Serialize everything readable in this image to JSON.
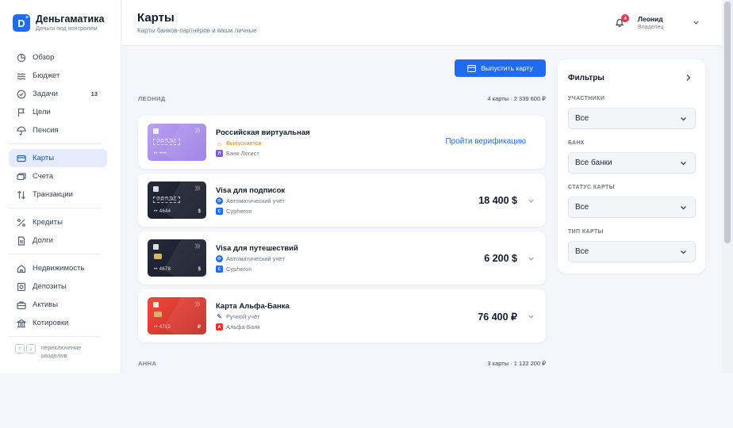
{
  "app": {
    "name": "Деньгаматика",
    "tagline": "Деньги под контролем",
    "logo_letter": "D",
    "logo_plus": "+"
  },
  "sidebar": {
    "items": [
      {
        "label": "Обзор",
        "icon": "pie-chart-icon"
      },
      {
        "label": "Бюджет",
        "icon": "waves-icon"
      },
      {
        "label": "Задачи",
        "icon": "check-circle-icon",
        "badge": "13"
      },
      {
        "label": "Цели",
        "icon": "flag-icon"
      },
      {
        "label": "Пенсия",
        "icon": "umbrella-icon"
      },
      {
        "label": "Карты",
        "icon": "card-icon",
        "active": true
      },
      {
        "label": "Счета",
        "icon": "wallet-icon"
      },
      {
        "label": "Транзакции",
        "icon": "arrows-icon"
      },
      {
        "label": "Кредиты",
        "icon": "percent-icon"
      },
      {
        "label": "Долги",
        "icon": "file-icon"
      },
      {
        "label": "Недвижимость",
        "icon": "home-icon"
      },
      {
        "label": "Депозиты",
        "icon": "safe-icon"
      },
      {
        "label": "Активы",
        "icon": "briefcase-icon"
      },
      {
        "label": "Котировки",
        "icon": "bank-icon"
      }
    ],
    "switcher": {
      "key_up": "↑",
      "key_down": "↓",
      "text": "переключение разделов"
    }
  },
  "header": {
    "title": "Карты",
    "subtitle": "Карты банков-партнёров и ваши личные",
    "notifications_count": "4",
    "user_name": "Леонид",
    "user_role": "Владелец"
  },
  "actions": {
    "issue_card": "Выпустить карту"
  },
  "groups": [
    {
      "name": "ЛЕОНИД",
      "summary": "4 карты · 2 339 600 ₽"
    },
    {
      "name": "АННА",
      "summary": "3 карты · 1 122 200 ₽"
    }
  ],
  "cards": [
    {
      "title": "Российская виртуальная",
      "status": "Выпускается",
      "bank": "Банк Логист",
      "action": "Пройти верификацию",
      "card_number": "•• ••••",
      "card_currency": "",
      "virtual_label": "VIRTUAL"
    },
    {
      "title": "Visa для подписок",
      "status": "Автоматический учёт",
      "bank": "Cypheron",
      "amount": "18 400 $",
      "card_number": "•• 4644",
      "card_currency": "$",
      "virtual_label": "VIRTUAL"
    },
    {
      "title": "Visa для путешествий",
      "status": "Автоматический учёт",
      "bank": "Cypheron",
      "amount": "6 200 $",
      "card_number": "•• 4678",
      "card_currency": "$"
    },
    {
      "title": "Карта Альфа-Банка",
      "status": "Ручной учёт",
      "bank": "Альфа-Банк",
      "amount": "76 400 ₽",
      "card_number": "•• 4712",
      "card_currency": "₽"
    }
  ],
  "filters": {
    "title": "Фильтры",
    "fields": [
      {
        "label": "УЧАСТНИКИ",
        "value": "Все"
      },
      {
        "label": "БАНК",
        "value": "Все банки"
      },
      {
        "label": "СТАТУС КАРТЫ",
        "value": "Все"
      },
      {
        "label": "ТИП КАРТЫ",
        "value": "Все"
      }
    ]
  },
  "colors": {
    "accent": "#1f6cf2",
    "active_nav_bg": "#e5ecfd",
    "pending": "#e08a17",
    "badge": "#e8334d"
  }
}
